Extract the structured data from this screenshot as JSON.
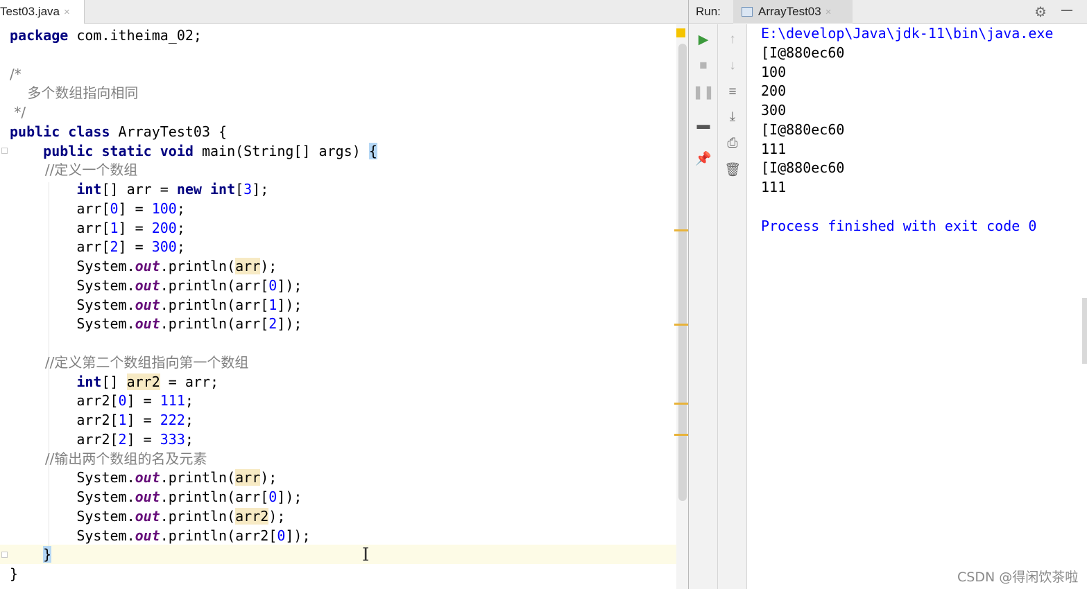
{
  "editor": {
    "tab": {
      "filename": "Test03.java",
      "close": "×"
    },
    "code_lines": [
      [
        {
          "t": "package",
          "c": "kw"
        },
        {
          "t": " com.itheima_02;"
        }
      ],
      [],
      [
        {
          "t": "/*",
          "c": "cmt"
        }
      ],
      [
        {
          "t": "    多个数组指向相同",
          "c": "cmt"
        }
      ],
      [
        {
          "t": " */",
          "c": "cmt"
        }
      ],
      [
        {
          "t": "public",
          "c": "kw"
        },
        {
          "t": " "
        },
        {
          "t": "class",
          "c": "kw"
        },
        {
          "t": " ArrayTest03 {"
        }
      ],
      [
        {
          "t": "    "
        },
        {
          "t": "public",
          "c": "kw"
        },
        {
          "t": " "
        },
        {
          "t": "static",
          "c": "kw"
        },
        {
          "t": " "
        },
        {
          "t": "void",
          "c": "kw"
        },
        {
          "t": " main(String[] args) "
        },
        {
          "t": "{",
          "c": "brace-hl"
        }
      ],
      [
        {
          "t": "        //定义一个数组",
          "c": "cmt"
        }
      ],
      [
        {
          "t": "        "
        },
        {
          "t": "int",
          "c": "kw"
        },
        {
          "t": "[] arr = "
        },
        {
          "t": "new",
          "c": "kw"
        },
        {
          "t": " "
        },
        {
          "t": "int",
          "c": "kw"
        },
        {
          "t": "["
        },
        {
          "t": "3",
          "c": "num"
        },
        {
          "t": "];"
        }
      ],
      [
        {
          "t": "        arr["
        },
        {
          "t": "0",
          "c": "num"
        },
        {
          "t": "] = "
        },
        {
          "t": "100",
          "c": "num"
        },
        {
          "t": ";"
        }
      ],
      [
        {
          "t": "        arr["
        },
        {
          "t": "1",
          "c": "num"
        },
        {
          "t": "] = "
        },
        {
          "t": "200",
          "c": "num"
        },
        {
          "t": ";"
        }
      ],
      [
        {
          "t": "        arr["
        },
        {
          "t": "2",
          "c": "num"
        },
        {
          "t": "] = "
        },
        {
          "t": "300",
          "c": "num"
        },
        {
          "t": ";"
        }
      ],
      [
        {
          "t": "        System."
        },
        {
          "t": "out",
          "c": "fld"
        },
        {
          "t": ".println("
        },
        {
          "t": "arr",
          "c": "hl"
        },
        {
          "t": ");"
        }
      ],
      [
        {
          "t": "        System."
        },
        {
          "t": "out",
          "c": "fld"
        },
        {
          "t": ".println(arr["
        },
        {
          "t": "0",
          "c": "num"
        },
        {
          "t": "]);"
        }
      ],
      [
        {
          "t": "        System."
        },
        {
          "t": "out",
          "c": "fld"
        },
        {
          "t": ".println(arr["
        },
        {
          "t": "1",
          "c": "num"
        },
        {
          "t": "]);"
        }
      ],
      [
        {
          "t": "        System."
        },
        {
          "t": "out",
          "c": "fld"
        },
        {
          "t": ".println(arr["
        },
        {
          "t": "2",
          "c": "num"
        },
        {
          "t": "]);"
        }
      ],
      [],
      [
        {
          "t": "        //定义第二个数组指向第一个数组",
          "c": "cmt"
        }
      ],
      [
        {
          "t": "        "
        },
        {
          "t": "int",
          "c": "kw"
        },
        {
          "t": "[] "
        },
        {
          "t": "arr2",
          "c": "hl"
        },
        {
          "t": " = arr;"
        }
      ],
      [
        {
          "t": "        arr2["
        },
        {
          "t": "0",
          "c": "num"
        },
        {
          "t": "] = "
        },
        {
          "t": "111",
          "c": "num"
        },
        {
          "t": ";"
        }
      ],
      [
        {
          "t": "        arr2["
        },
        {
          "t": "1",
          "c": "num"
        },
        {
          "t": "] = "
        },
        {
          "t": "222",
          "c": "num"
        },
        {
          "t": ";"
        }
      ],
      [
        {
          "t": "        arr2["
        },
        {
          "t": "2",
          "c": "num"
        },
        {
          "t": "] = "
        },
        {
          "t": "333",
          "c": "num"
        },
        {
          "t": ";"
        }
      ],
      [
        {
          "t": "        //输出两个数组的名及元素",
          "c": "cmt"
        }
      ],
      [
        {
          "t": "        System."
        },
        {
          "t": "out",
          "c": "fld"
        },
        {
          "t": ".println("
        },
        {
          "t": "arr",
          "c": "hl"
        },
        {
          "t": ");"
        }
      ],
      [
        {
          "t": "        System."
        },
        {
          "t": "out",
          "c": "fld"
        },
        {
          "t": ".println(arr["
        },
        {
          "t": "0",
          "c": "num"
        },
        {
          "t": "]);"
        }
      ],
      [
        {
          "t": "        System."
        },
        {
          "t": "out",
          "c": "fld"
        },
        {
          "t": ".println("
        },
        {
          "t": "arr2",
          "c": "hl"
        },
        {
          "t": ");"
        }
      ],
      [
        {
          "t": "        System."
        },
        {
          "t": "out",
          "c": "fld"
        },
        {
          "t": ".println(arr2["
        },
        {
          "t": "0",
          "c": "num"
        },
        {
          "t": "]);"
        }
      ],
      [
        {
          "t": "    "
        },
        {
          "t": "}",
          "c": "brace-hl"
        }
      ],
      [
        {
          "t": "}"
        }
      ]
    ]
  },
  "run_panel": {
    "label": "Run:",
    "tab_name": "ArrayTest03",
    "tab_close": "×",
    "gear_icon": "⚙",
    "left_toolbar": [
      {
        "name": "rerun-icon",
        "glyph": "▶",
        "color": "#3c9a3c"
      },
      {
        "name": "stop-icon",
        "glyph": "■",
        "color": "#b5b5b5"
      },
      {
        "name": "pause-icon",
        "glyph": "❚❚",
        "color": "#b5b5b5"
      },
      {
        "name": "layout-icon",
        "glyph": "▬",
        "color": "#555555"
      },
      {
        "name": "pin-icon",
        "glyph": "📌",
        "color": "#777777"
      }
    ],
    "right_toolbar": [
      {
        "name": "up-arrow-icon",
        "glyph": "↑",
        "color": "#b5b5b5"
      },
      {
        "name": "down-arrow-icon",
        "glyph": "↓",
        "color": "#b5b5b5"
      },
      {
        "name": "soft-wrap-icon",
        "glyph": "≡",
        "color": "#666666"
      },
      {
        "name": "scroll-to-end-icon",
        "glyph": "⤓",
        "color": "#666666"
      },
      {
        "name": "print-icon",
        "glyph": "⎙",
        "color": "#666666"
      },
      {
        "name": "trash-icon",
        "glyph": "🗑",
        "color": "#666666"
      }
    ],
    "console_lines": [
      {
        "text": "E:\\develop\\Java\\jdk-11\\bin\\java.exe",
        "kind": "cmd"
      },
      {
        "text": "[I@880ec60",
        "kind": "out"
      },
      {
        "text": "100",
        "kind": "out"
      },
      {
        "text": "200",
        "kind": "out"
      },
      {
        "text": "300",
        "kind": "out"
      },
      {
        "text": "[I@880ec60",
        "kind": "out"
      },
      {
        "text": "111",
        "kind": "out"
      },
      {
        "text": "[I@880ec60",
        "kind": "out"
      },
      {
        "text": "111",
        "kind": "out"
      },
      {
        "text": "",
        "kind": "out"
      },
      {
        "text": "Process finished with exit code 0",
        "kind": "exit"
      }
    ]
  },
  "watermark": "CSDN @得闲饮茶啦",
  "colors": {
    "keyword": "#000080",
    "number": "#0000ff",
    "comment": "#808080",
    "field": "#660e7a",
    "highlight": "#f7eac4",
    "console_system": "#0000ff"
  }
}
